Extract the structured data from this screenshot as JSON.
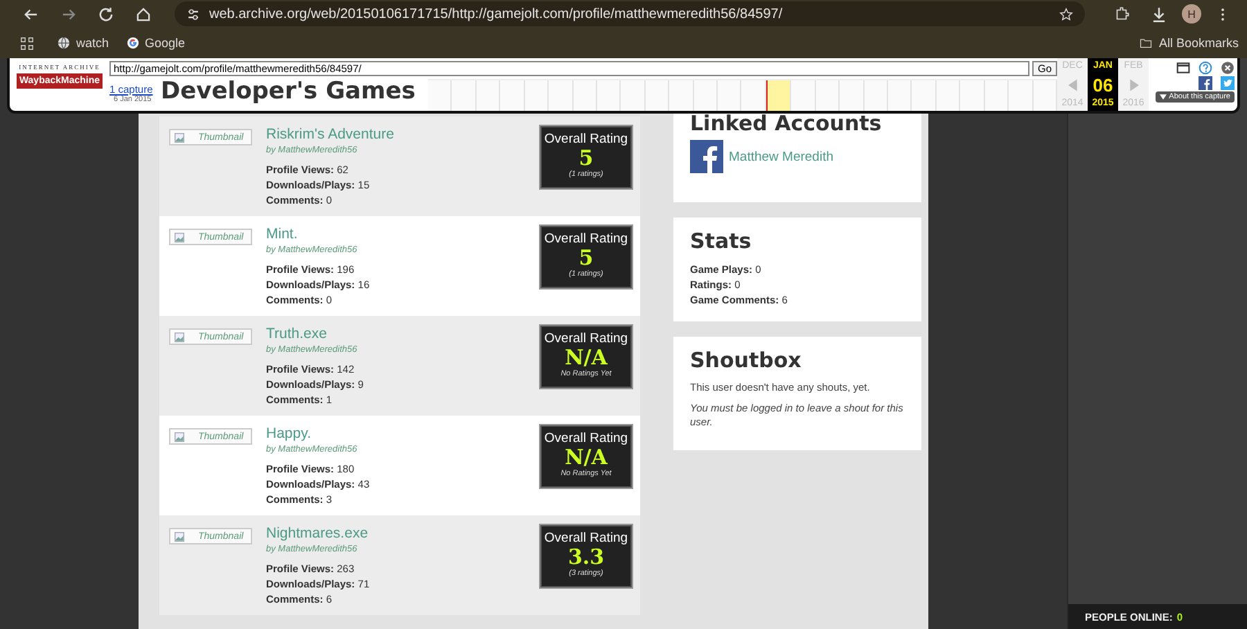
{
  "browser": {
    "url": "web.archive.org/web/20150106171715/http://gamejolt.com/profile/matthewmeredith56/84597/",
    "avatar": "H",
    "bookmarks": [
      {
        "label": "watch",
        "kind": "globe"
      },
      {
        "label": "Google",
        "kind": "google"
      }
    ],
    "all_bookmarks": "All Bookmarks"
  },
  "wayback": {
    "org": "INTERNET ARCHIVE",
    "logo": "WaybackMachine",
    "url": "http://gamejolt.com/profile/matthewmeredith56/84597/",
    "go": "Go",
    "captures": "1 capture",
    "capture_date": "6 Jan 2015",
    "prev_month": "DEC",
    "month": "JAN",
    "day": "06",
    "year": "2015",
    "next_month": "FEB",
    "prev_year": "2014",
    "next_year": "2016",
    "about": "About this capture"
  },
  "games_heading": "Developer's Games",
  "games": [
    {
      "title": "Riskrim's Adventure",
      "thumbnail": "Thumbnail",
      "by": "by MatthewMeredith56",
      "stats": [
        {
          "label": "Profile Views:",
          "value": "62"
        },
        {
          "label": "Downloads/Plays:",
          "value": "15"
        },
        {
          "label": "Comments:",
          "value": "0"
        }
      ],
      "rating_label": "Overall Rating",
      "rating": "5",
      "rating_note": "(1 ratings)"
    },
    {
      "title": "Mint.",
      "thumbnail": "Thumbnail",
      "by": "by MatthewMeredith56",
      "stats": [
        {
          "label": "Profile Views:",
          "value": "196"
        },
        {
          "label": "Downloads/Plays:",
          "value": "16"
        },
        {
          "label": "Comments:",
          "value": "0"
        }
      ],
      "rating_label": "Overall Rating",
      "rating": "5",
      "rating_note": "(1 ratings)"
    },
    {
      "title": "Truth.exe",
      "thumbnail": "Thumbnail",
      "by": "by MatthewMeredith56",
      "stats": [
        {
          "label": "Profile Views:",
          "value": "142"
        },
        {
          "label": "Downloads/Plays:",
          "value": "9"
        },
        {
          "label": "Comments:",
          "value": "1"
        }
      ],
      "rating_label": "Overall Rating",
      "rating": "N/A",
      "rating_note": "No Ratings Yet"
    },
    {
      "title": "Happy.",
      "thumbnail": "Thumbnail",
      "by": "by MatthewMeredith56",
      "stats": [
        {
          "label": "Profile Views:",
          "value": "180"
        },
        {
          "label": "Downloads/Plays:",
          "value": "43"
        },
        {
          "label": "Comments:",
          "value": "3"
        }
      ],
      "rating_label": "Overall Rating",
      "rating": "N/A",
      "rating_note": "No Ratings Yet"
    },
    {
      "title": "Nightmares.exe",
      "thumbnail": "Thumbnail",
      "by": "by MatthewMeredith56",
      "stats": [
        {
          "label": "Profile Views:",
          "value": "263"
        },
        {
          "label": "Downloads/Plays:",
          "value": "71"
        },
        {
          "label": "Comments:",
          "value": "6"
        }
      ],
      "rating_label": "Overall Rating",
      "rating": "3.3",
      "rating_note": "(3 ratings)"
    }
  ],
  "linked_accounts": {
    "heading": "Linked Accounts",
    "name": "Matthew Meredith"
  },
  "stats": {
    "heading": "Stats",
    "items": [
      {
        "label": "Game Plays:",
        "value": "0"
      },
      {
        "label": "Ratings:",
        "value": "0"
      },
      {
        "label": "Game Comments:",
        "value": "6"
      }
    ]
  },
  "shoutbox": {
    "heading": "Shoutbox",
    "empty": "This user doesn't have any shouts, yet.",
    "login_note": "You must be logged in to leave a shout for this user."
  },
  "footer": {
    "label": "PEOPLE ONLINE:",
    "count": "0"
  }
}
